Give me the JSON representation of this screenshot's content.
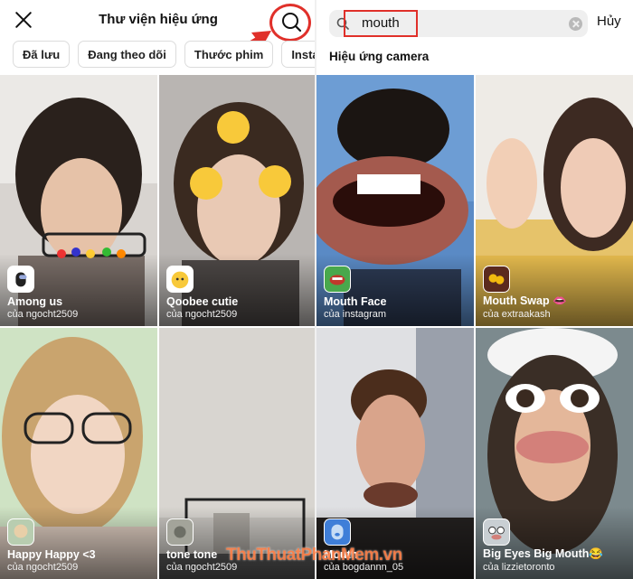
{
  "left": {
    "title": "Thư viện hiệu ứng",
    "chips": [
      "Đã lưu",
      "Đang theo dõi",
      "Thước phim",
      "Instagram"
    ],
    "effects": [
      {
        "name": "Among us",
        "author": "của ngocht2509"
      },
      {
        "name": "Qoobee cutie",
        "author": "của ngocht2509"
      },
      {
        "name": "Happy Happy <3",
        "author": "của ngocht2509"
      },
      {
        "name": "tone tone",
        "author": "của ngocht2509"
      }
    ]
  },
  "right": {
    "search_value": "mouth",
    "cancel_label": "Hủy",
    "section_title": "Hiệu ứng camera",
    "effects": [
      {
        "name": "Mouth Face",
        "author": "của instagram"
      },
      {
        "name": "Mouth Swap 👄",
        "author": "của extraakash"
      },
      {
        "name": "Mouth",
        "author": "của bogdannn_05"
      },
      {
        "name": "Big Eyes Big Mouth😂",
        "author": "của lizzietoronto"
      }
    ]
  },
  "watermark": "ThuThuatPhanMem.vn",
  "colors": {
    "highlight": "#e0302a",
    "watermark": "#ff7a3c"
  }
}
